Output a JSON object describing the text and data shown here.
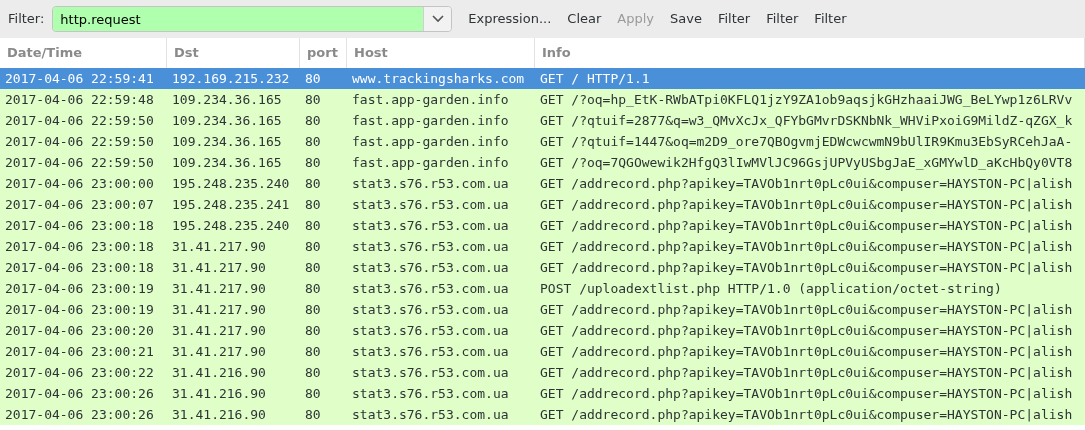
{
  "filter_bar": {
    "label": "Filter:",
    "value": "http.request",
    "valid": true,
    "buttons": [
      {
        "label": "Expression...",
        "disabled": false
      },
      {
        "label": "Clear",
        "disabled": false
      },
      {
        "label": "Apply",
        "disabled": true
      },
      {
        "label": "Save",
        "disabled": false
      },
      {
        "label": "Filter",
        "disabled": false
      },
      {
        "label": "Filter",
        "disabled": false
      },
      {
        "label": "Filter",
        "disabled": false
      }
    ]
  },
  "table": {
    "columns": [
      "Date/Time",
      "Dst",
      "port",
      "Host",
      "Info"
    ],
    "rows": [
      {
        "selected": true,
        "cells": [
          "2017-04-06 22:59:41",
          "192.169.215.232",
          "80",
          "www.trackingsharks.com",
          "GET / HTTP/1.1"
        ]
      },
      {
        "selected": false,
        "cells": [
          "2017-04-06 22:59:48",
          "109.234.36.165",
          "80",
          "fast.app-garden.info",
          "GET /?oq=hp_EtK-RWbATpi0KFLQ1jzY9ZA1ob9aqsjkGHzhaaiJWG_BeLYwp1z6LRVv"
        ]
      },
      {
        "selected": false,
        "cells": [
          "2017-04-06 22:59:50",
          "109.234.36.165",
          "80",
          "fast.app-garden.info",
          "GET /?qtuif=2877&q=w3_QMvXcJx_QFYbGMvrDSKNbNk_WHViPxoiG9MildZ-qZGX_k"
        ]
      },
      {
        "selected": false,
        "cells": [
          "2017-04-06 22:59:50",
          "109.234.36.165",
          "80",
          "fast.app-garden.info",
          "GET /?qtuif=1447&oq=m2D9_ore7QBOgvmjEDWcwcwmN9bUlIR9Kmu3EbSyRCehJaA-"
        ]
      },
      {
        "selected": false,
        "cells": [
          "2017-04-06 22:59:50",
          "109.234.36.165",
          "80",
          "fast.app-garden.info",
          "GET /?oq=7QGOwewik2HfgQ3lIwMVlJC96GsjUPVyUSbgJaE_xGMYwlD_aKcHbQy0VT8"
        ]
      },
      {
        "selected": false,
        "cells": [
          "2017-04-06 23:00:00",
          "195.248.235.240",
          "80",
          "stat3.s76.r53.com.ua",
          "GET /addrecord.php?apikey=TAVOb1nrt0pLc0ui&compuser=HAYSTON-PC|alish"
        ]
      },
      {
        "selected": false,
        "cells": [
          "2017-04-06 23:00:07",
          "195.248.235.241",
          "80",
          "stat3.s76.r53.com.ua",
          "GET /addrecord.php?apikey=TAVOb1nrt0pLc0ui&compuser=HAYSTON-PC|alish"
        ]
      },
      {
        "selected": false,
        "cells": [
          "2017-04-06 23:00:18",
          "195.248.235.240",
          "80",
          "stat3.s76.r53.com.ua",
          "GET /addrecord.php?apikey=TAVOb1nrt0pLc0ui&compuser=HAYSTON-PC|alish"
        ]
      },
      {
        "selected": false,
        "cells": [
          "2017-04-06 23:00:18",
          "31.41.217.90",
          "80",
          "stat3.s76.r53.com.ua",
          "GET /addrecord.php?apikey=TAVOb1nrt0pLc0ui&compuser=HAYSTON-PC|alish"
        ]
      },
      {
        "selected": false,
        "cells": [
          "2017-04-06 23:00:18",
          "31.41.217.90",
          "80",
          "stat3.s76.r53.com.ua",
          "GET /addrecord.php?apikey=TAVOb1nrt0pLc0ui&compuser=HAYSTON-PC|alish"
        ]
      },
      {
        "selected": false,
        "cells": [
          "2017-04-06 23:00:19",
          "31.41.217.90",
          "80",
          "stat3.s76.r53.com.ua",
          "POST /uploadextlist.php HTTP/1.0  (application/octet-string)"
        ]
      },
      {
        "selected": false,
        "cells": [
          "2017-04-06 23:00:19",
          "31.41.217.90",
          "80",
          "stat3.s76.r53.com.ua",
          "GET /addrecord.php?apikey=TAVOb1nrt0pLc0ui&compuser=HAYSTON-PC|alish"
        ]
      },
      {
        "selected": false,
        "cells": [
          "2017-04-06 23:00:20",
          "31.41.217.90",
          "80",
          "stat3.s76.r53.com.ua",
          "GET /addrecord.php?apikey=TAVOb1nrt0pLc0ui&compuser=HAYSTON-PC|alish"
        ]
      },
      {
        "selected": false,
        "cells": [
          "2017-04-06 23:00:21",
          "31.41.217.90",
          "80",
          "stat3.s76.r53.com.ua",
          "GET /addrecord.php?apikey=TAVOb1nrt0pLc0ui&compuser=HAYSTON-PC|alish"
        ]
      },
      {
        "selected": false,
        "cells": [
          "2017-04-06 23:00:22",
          "31.41.216.90",
          "80",
          "stat3.s76.r53.com.ua",
          "GET /addrecord.php?apikey=TAVOb1nrt0pLc0ui&compuser=HAYSTON-PC|alish"
        ]
      },
      {
        "selected": false,
        "cells": [
          "2017-04-06 23:00:26",
          "31.41.216.90",
          "80",
          "stat3.s76.r53.com.ua",
          "GET /addrecord.php?apikey=TAVOb1nrt0pLc0ui&compuser=HAYSTON-PC|alish"
        ]
      },
      {
        "selected": false,
        "cells": [
          "2017-04-06 23:00:26",
          "31.41.216.90",
          "80",
          "stat3.s76.r53.com.ua",
          "GET /addrecord.php?apikey=TAVOb1nrt0pLc0ui&compuser=HAYSTON-PC|alish"
        ]
      }
    ]
  }
}
